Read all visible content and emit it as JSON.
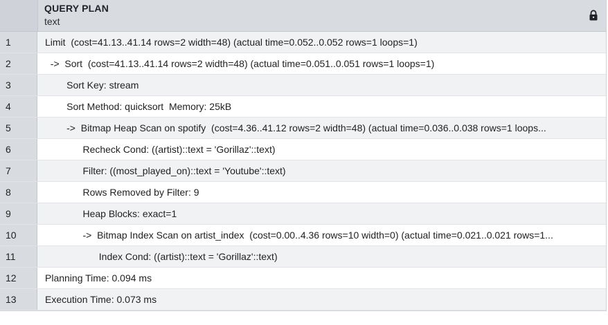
{
  "grid": {
    "column_title": "QUERY PLAN",
    "column_type": "text",
    "lock_icon": "lock-icon",
    "rows": [
      {
        "num": "1",
        "text": "Limit  (cost=41.13..41.14 rows=2 width=48) (actual time=0.052..0.052 rows=1 loops=1)"
      },
      {
        "num": "2",
        "text": "  ->  Sort  (cost=41.13..41.14 rows=2 width=48) (actual time=0.051..0.051 rows=1 loops=1)"
      },
      {
        "num": "3",
        "text": "        Sort Key: stream"
      },
      {
        "num": "4",
        "text": "        Sort Method: quicksort  Memory: 25kB"
      },
      {
        "num": "5",
        "text": "        ->  Bitmap Heap Scan on spotify  (cost=4.36..41.12 rows=2 width=48) (actual time=0.036..0.038 rows=1 loops..."
      },
      {
        "num": "6",
        "text": "              Recheck Cond: ((artist)::text = 'Gorillaz'::text)"
      },
      {
        "num": "7",
        "text": "              Filter: ((most_played_on)::text = 'Youtube'::text)"
      },
      {
        "num": "8",
        "text": "              Rows Removed by Filter: 9"
      },
      {
        "num": "9",
        "text": "              Heap Blocks: exact=1"
      },
      {
        "num": "10",
        "text": "              ->  Bitmap Index Scan on artist_index  (cost=0.00..4.36 rows=10 width=0) (actual time=0.021..0.021 rows=1..."
      },
      {
        "num": "11",
        "text": "                    Index Cond: ((artist)::text = 'Gorillaz'::text)"
      },
      {
        "num": "12",
        "text": "Planning Time: 0.094 ms"
      },
      {
        "num": "13",
        "text": "Execution Time: 0.073 ms"
      }
    ]
  }
}
